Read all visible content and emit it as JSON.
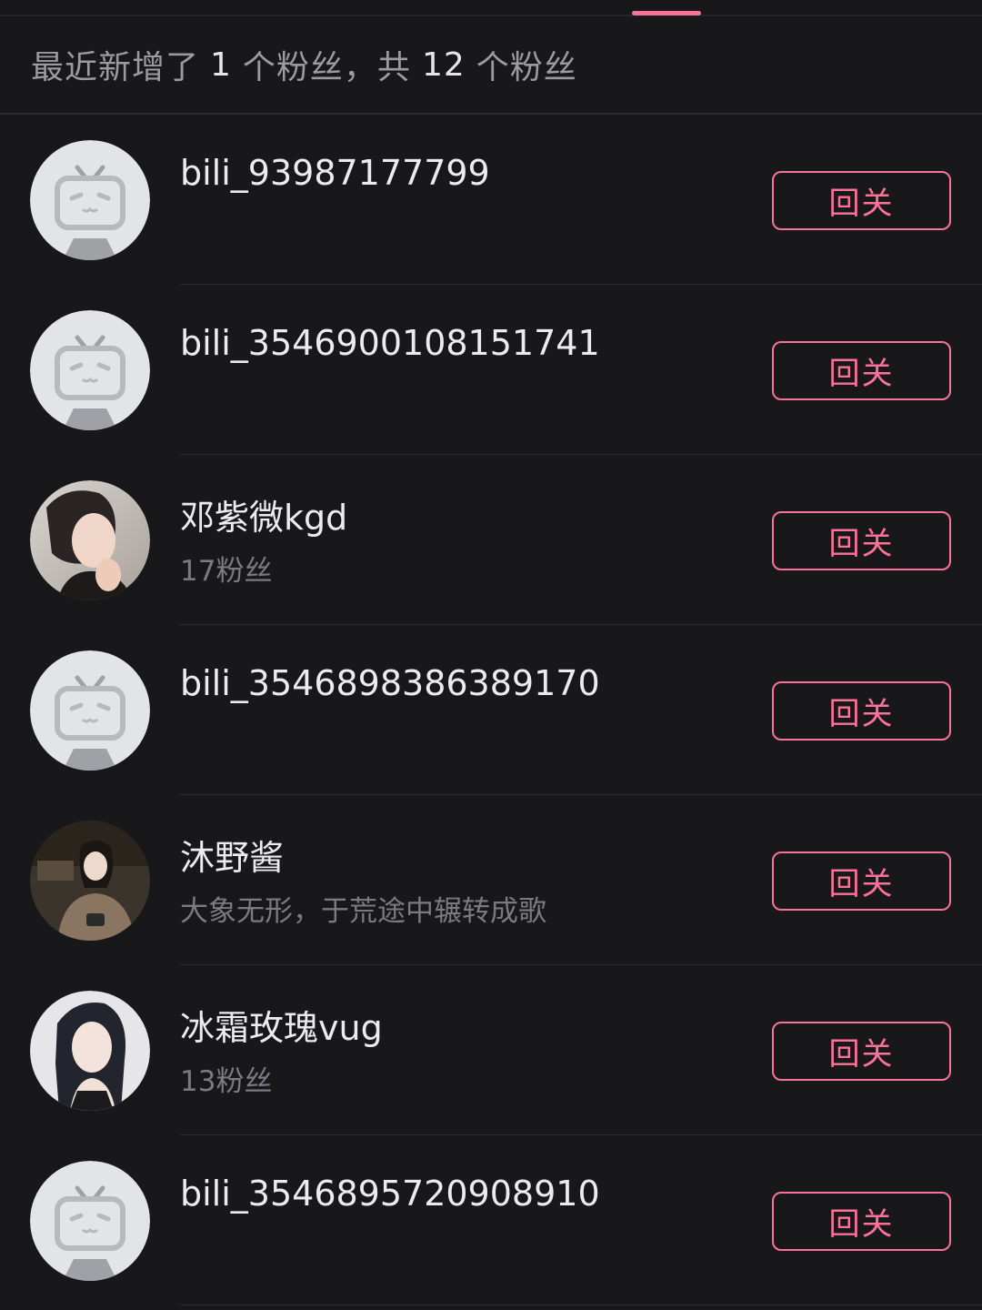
{
  "colors": {
    "background": "#18181b",
    "accent": "#fb7299",
    "divider": "#2c2c30"
  },
  "summary": {
    "prefix": "最近新增了",
    "new_count": "1",
    "middle": "个粉丝，共",
    "total_count": "12",
    "suffix": "个粉丝"
  },
  "fans": [
    {
      "name": "bili_93987177799",
      "subtitle": "",
      "avatar": "default-tv-avatar",
      "button_label": "回关"
    },
    {
      "name": "bili_3546900108151741",
      "subtitle": "",
      "avatar": "default-tv-avatar",
      "button_label": "回关"
    },
    {
      "name": "邓紫微kgd",
      "subtitle": "17粉丝",
      "avatar": "photo-avatar",
      "button_label": "回关"
    },
    {
      "name": "bili_3546898386389170",
      "subtitle": "",
      "avatar": "default-tv-avatar",
      "button_label": "回关"
    },
    {
      "name": "沐野酱",
      "subtitle": "大象无形，于荒途中辗转成歌",
      "avatar": "photo-avatar",
      "button_label": "回关"
    },
    {
      "name": "冰霜玫瑰vug",
      "subtitle": "13粉丝",
      "avatar": "photo-avatar",
      "button_label": "回关"
    },
    {
      "name": "bili_3546895720908910",
      "subtitle": "",
      "avatar": "default-tv-avatar",
      "button_label": "回关"
    }
  ]
}
